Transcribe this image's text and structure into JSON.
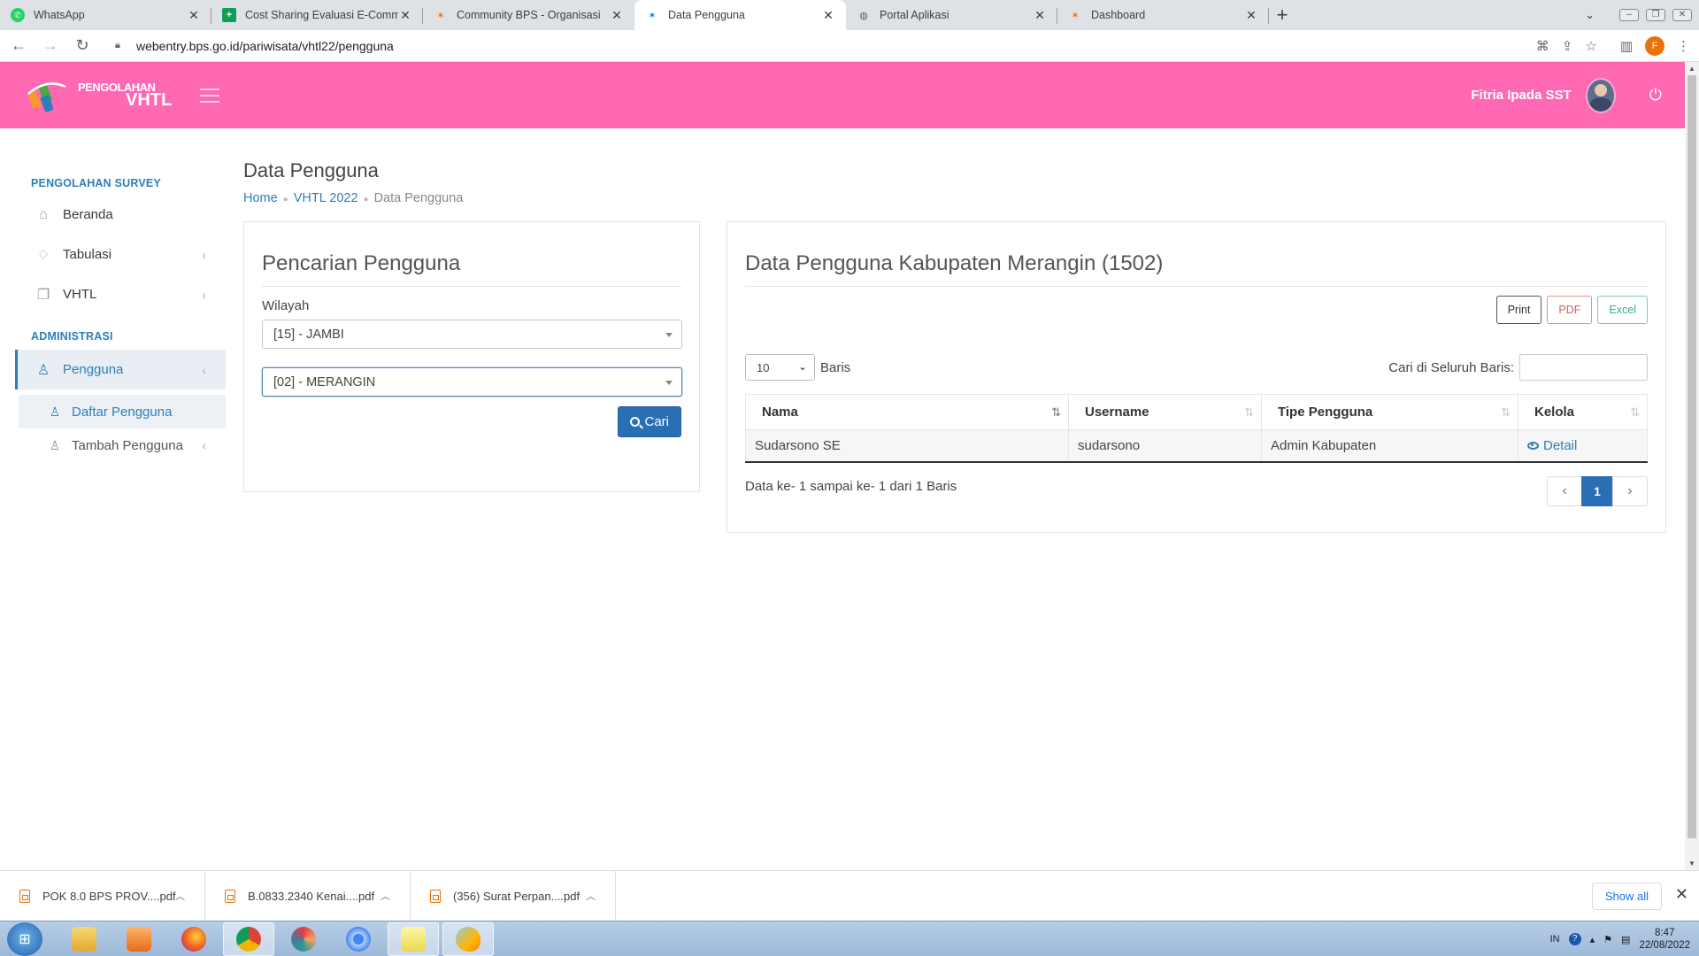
{
  "browser": {
    "tabs": [
      {
        "title": "WhatsApp",
        "icon": "whatsapp-icon",
        "active": false
      },
      {
        "title": "Cost Sharing Evaluasi E-Commerce",
        "icon": "sheets-icon",
        "active": false
      },
      {
        "title": "Community BPS - Organisasi",
        "icon": "bps-icon",
        "active": false
      },
      {
        "title": "Data Pengguna",
        "icon": "bps-icon",
        "active": true
      },
      {
        "title": "Portal Aplikasi",
        "icon": "globe-icon",
        "active": false
      },
      {
        "title": "Dashboard",
        "icon": "bps-icon",
        "active": false
      }
    ],
    "url": "webentry.bps.go.id/pariwisata/vhtl22/pengguna",
    "profile_initial": "F"
  },
  "header": {
    "logo_line1": "PENGOLAHAN",
    "logo_line2": "VHTL",
    "user_name": "Fitria Ipada SST",
    "brand_color": "#ff69b4"
  },
  "sidebar": {
    "section1": "PENGOLAHAN SURVEY",
    "items1": [
      {
        "label": "Beranda",
        "icon": "home-icon"
      },
      {
        "label": "Tabulasi",
        "icon": "lightbulb-icon"
      },
      {
        "label": "VHTL",
        "icon": "copy-icon"
      }
    ],
    "section2": "ADMINISTRASI",
    "pengguna": "Pengguna",
    "sub_items": [
      {
        "label": "Daftar Pengguna",
        "icon": "user-icon"
      },
      {
        "label": "Tambah Pengguna",
        "icon": "user-icon"
      }
    ]
  },
  "page": {
    "title": "Data Pengguna",
    "breadcrumb": [
      "Home",
      "VHTL 2022",
      "Data Pengguna"
    ]
  },
  "search_panel": {
    "title": "Pencarian Pengguna",
    "wilayah_label": "Wilayah",
    "province_value": "[15] - JAMBI",
    "regency_value": "[02] - MERANGIN",
    "search_button": "Cari"
  },
  "data_panel": {
    "title": "Data Pengguna Kabupaten Merangin (1502)",
    "export_buttons": {
      "print": "Print",
      "pdf": "PDF",
      "excel": "Excel"
    },
    "page_length": "10",
    "page_length_suffix": "Baris",
    "filter_label": "Cari di Seluruh Baris:",
    "columns": [
      "Nama",
      "Username",
      "Tipe Pengguna",
      "Kelola"
    ],
    "rows": [
      {
        "nama": "Sudarsono SE",
        "username": "sudarsono",
        "tipe": "Admin Kabupaten",
        "kelola": "Detail"
      }
    ],
    "info": "Data ke- 1 sampai ke- 1 dari 1 Baris",
    "pagination": {
      "prev": "‹",
      "current": "1",
      "next": "›"
    }
  },
  "downloads": {
    "items": [
      "POK 8.0 BPS PROV....pdf",
      "B.0833.2340 Kenai....pdf",
      "(356) Surat Perpan....pdf"
    ],
    "show_all": "Show all"
  },
  "taskbar": {
    "lang": "IN",
    "time": "8:47",
    "date": "22/08/2022"
  }
}
